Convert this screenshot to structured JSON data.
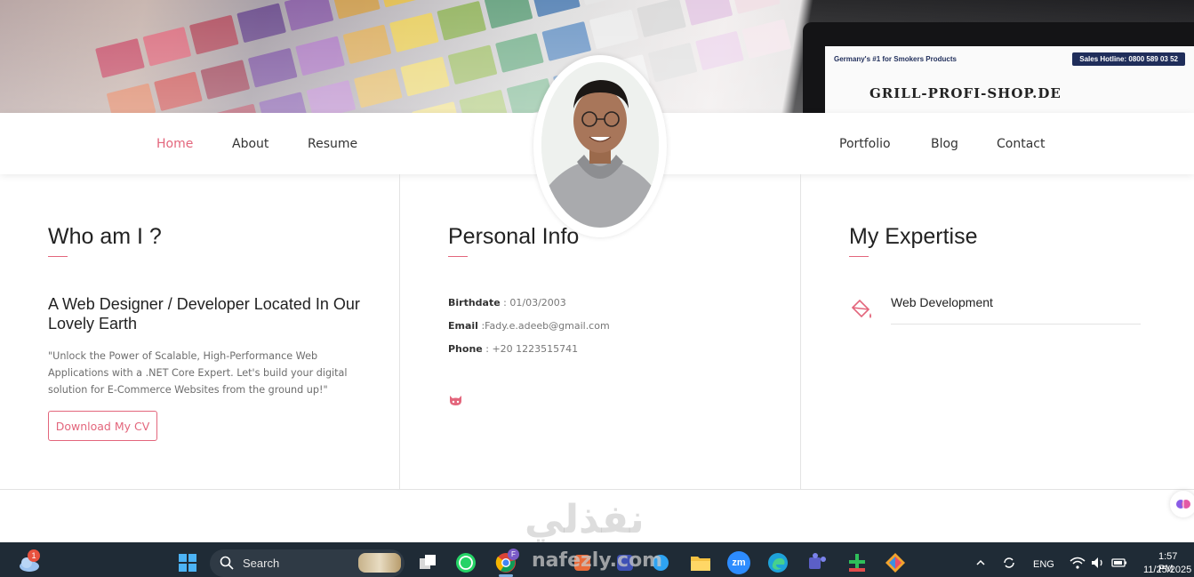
{
  "nav": {
    "left": [
      "Home",
      "About",
      "Resume"
    ],
    "right": [
      "Portfolio",
      "Blog",
      "Contact"
    ],
    "active": "Home"
  },
  "hero": {
    "screen_top_left": "Germany's #1 for Smokers Products",
    "screen_top_right": "Sales Hotline: 0800 589 03 52",
    "screen_logo": "GRILL-PROFI-SHOP.DE"
  },
  "about": {
    "title": "Who am I ?",
    "subtitle": "A Web Designer / Developer Located In Our Lovely Earth",
    "quote": "\"Unlock the Power of Scalable, High-Performance Web Applications with a .NET Core Expert. Let's build your digital solution for E-Commerce Websites from the ground up!\"",
    "cv_button": "Download My CV"
  },
  "personal": {
    "title": "Personal Info",
    "birthdate_label": "Birthdate",
    "birthdate_value": " : 01/03/2003",
    "email_label": "Email",
    "email_value": " :Fady.e.adeeb@gmail.com",
    "phone_label": "Phone",
    "phone_value": " : +20 1223515741"
  },
  "expertise": {
    "title": "My Expertise",
    "items": [
      "Web Development"
    ]
  },
  "watermark": {
    "arabic": "نفذلي",
    "latin": "nafezly.com"
  },
  "taskbar": {
    "weather_badge": "1",
    "search_label": "Search",
    "chrome_badge": "F",
    "zoom_label": "zm",
    "lang": "ENG",
    "time": "1:57 PM",
    "date": "11/25/2025"
  },
  "colors": {
    "accent": "#e3667c",
    "taskbar": "#1f2b36"
  }
}
